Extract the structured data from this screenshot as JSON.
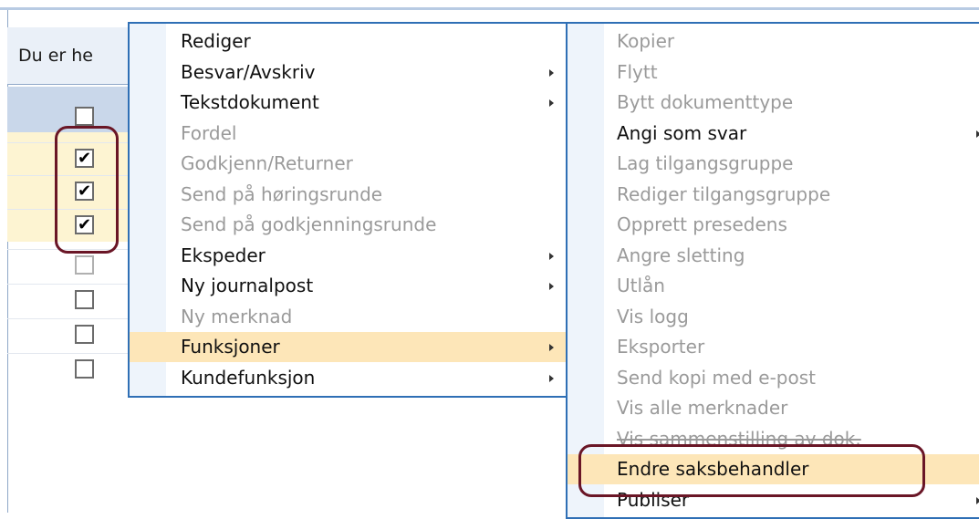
{
  "breadcrumb": {
    "text": "Du er he"
  },
  "grid": {
    "rows": [
      {
        "checked": false
      },
      {
        "checked": true
      },
      {
        "checked": true
      },
      {
        "checked": true
      },
      {
        "checked": false
      },
      {
        "checked": false
      },
      {
        "checked": false
      },
      {
        "checked": false
      }
    ]
  },
  "context_menu": {
    "items": [
      {
        "label": "Rediger",
        "enabled": true,
        "submenu": false
      },
      {
        "label": "Besvar/Avskriv",
        "enabled": true,
        "submenu": true
      },
      {
        "label": "Tekstdokument",
        "enabled": true,
        "submenu": true
      },
      {
        "label": "Fordel",
        "enabled": false,
        "submenu": false
      },
      {
        "label": "Godkjenn/Returner",
        "enabled": false,
        "submenu": false
      },
      {
        "label": "Send på høringsrunde",
        "enabled": false,
        "submenu": false
      },
      {
        "label": "Send på godkjenningsrunde",
        "enabled": false,
        "submenu": false
      },
      {
        "label": "Ekspeder",
        "enabled": true,
        "submenu": true
      },
      {
        "label": "Ny journalpost",
        "enabled": true,
        "submenu": true
      },
      {
        "label": "Ny merknad",
        "enabled": false,
        "submenu": false
      },
      {
        "label": "Funksjoner",
        "enabled": true,
        "submenu": true,
        "highlighted": true
      },
      {
        "label": "Kundefunksjon",
        "enabled": true,
        "submenu": true
      }
    ]
  },
  "submenu_funksjoner": {
    "items": [
      {
        "label": "Kopier",
        "enabled": false,
        "submenu": false
      },
      {
        "label": "Flytt",
        "enabled": false,
        "submenu": false
      },
      {
        "label": "Bytt dokumenttype",
        "enabled": false,
        "submenu": false
      },
      {
        "label": "Angi som svar",
        "enabled": true,
        "submenu": true
      },
      {
        "label": "Lag tilgangsgruppe",
        "enabled": false,
        "submenu": false
      },
      {
        "label": "Rediger tilgangsgruppe",
        "enabled": false,
        "submenu": false
      },
      {
        "label": "Opprett presedens",
        "enabled": false,
        "submenu": false
      },
      {
        "label": "Angre sletting",
        "enabled": false,
        "submenu": false
      },
      {
        "label": "Utlån",
        "enabled": false,
        "submenu": false
      },
      {
        "label": "Vis logg",
        "enabled": false,
        "submenu": false
      },
      {
        "label": "Eksporter",
        "enabled": false,
        "submenu": false
      },
      {
        "label": "Send kopi med e-post",
        "enabled": false,
        "submenu": false
      },
      {
        "label": "Vis alle merknader",
        "enabled": false,
        "submenu": false
      },
      {
        "label": "Vis sammenstilling av dok.",
        "enabled": false,
        "submenu": false
      },
      {
        "label": "Endre saksbehandler",
        "enabled": true,
        "submenu": false,
        "highlighted": true
      },
      {
        "label": "Publiser",
        "enabled": true,
        "submenu": true
      }
    ]
  },
  "colors": {
    "menu_border": "#2f6fb5",
    "hover_highlight": "#fde6b8",
    "annotation": "#6a1626",
    "disabled_text": "#9a9a9a"
  }
}
